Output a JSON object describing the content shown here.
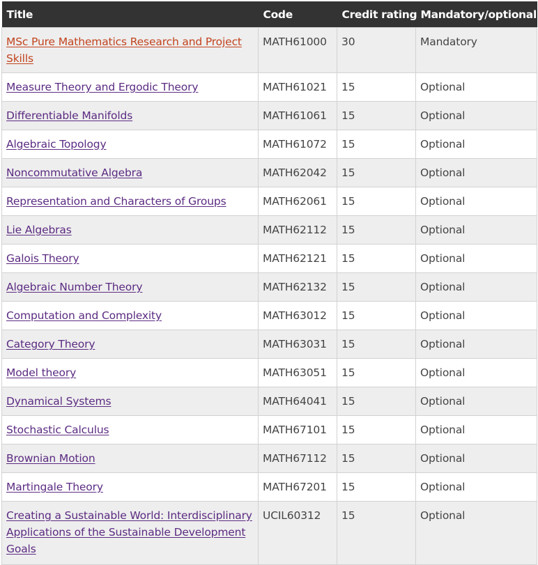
{
  "table": {
    "headers": {
      "title": "Title",
      "code": "Code",
      "credit": "Credit rating",
      "mandatory": "Mandatory/optional"
    },
    "rows": [
      {
        "title": "MSc Pure Mathematics Research and Project Skills",
        "code": "MATH61000",
        "credit": "30",
        "status": "Mandatory",
        "active": true
      },
      {
        "title": "Measure Theory and Ergodic Theory",
        "code": "MATH61021",
        "credit": "15",
        "status": "Optional"
      },
      {
        "title": "Differentiable Manifolds",
        "code": "MATH61061",
        "credit": "15",
        "status": "Optional"
      },
      {
        "title": "Algebraic Topology",
        "code": "MATH61072",
        "credit": "15",
        "status": "Optional"
      },
      {
        "title": "Noncommutative Algebra",
        "code": "MATH62042",
        "credit": "15",
        "status": "Optional"
      },
      {
        "title": "Representation and Characters of Groups",
        "code": "MATH62061",
        "credit": "15",
        "status": "Optional"
      },
      {
        "title": "Lie Algebras",
        "code": "MATH62112",
        "credit": "15",
        "status": "Optional"
      },
      {
        "title": "Galois Theory",
        "code": "MATH62121",
        "credit": "15",
        "status": "Optional"
      },
      {
        "title": "Algebraic Number Theory",
        "code": "MATH62132",
        "credit": "15",
        "status": "Optional"
      },
      {
        "title": "Computation and Complexity",
        "code": "MATH63012",
        "credit": "15",
        "status": "Optional"
      },
      {
        "title": "Category Theory",
        "code": "MATH63031",
        "credit": "15",
        "status": "Optional"
      },
      {
        "title": "Model theory",
        "code": "MATH63051",
        "credit": "15",
        "status": "Optional"
      },
      {
        "title": "Dynamical Systems",
        "code": "MATH64041",
        "credit": "15",
        "status": "Optional"
      },
      {
        "title": "Stochastic Calculus",
        "code": "MATH67101",
        "credit": "15",
        "status": "Optional"
      },
      {
        "title": "Brownian Motion",
        "code": "MATH67112",
        "credit": "15",
        "status": "Optional"
      },
      {
        "title": "Martingale Theory",
        "code": "MATH67201",
        "credit": "15",
        "status": "Optional"
      },
      {
        "title": "Creating a Sustainable World: Interdisciplinary Applications of the Sustainable Development Goals",
        "code": "UCIL60312",
        "credit": "15",
        "status": "Optional"
      }
    ]
  }
}
